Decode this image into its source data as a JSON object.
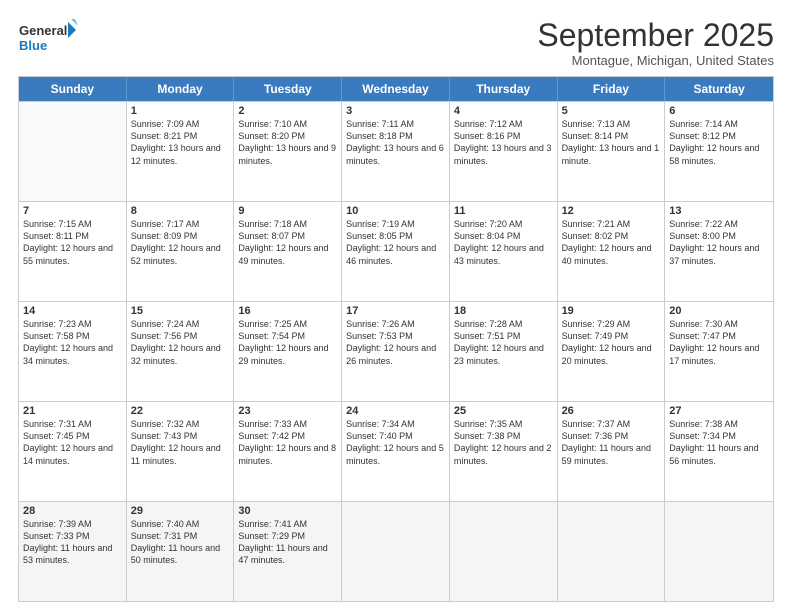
{
  "logo": {
    "line1": "General",
    "line2": "Blue"
  },
  "title": "September 2025",
  "location": "Montague, Michigan, United States",
  "header_days": [
    "Sunday",
    "Monday",
    "Tuesday",
    "Wednesday",
    "Thursday",
    "Friday",
    "Saturday"
  ],
  "weeks": [
    [
      {
        "day": "",
        "sunrise": "",
        "sunset": "",
        "daylight": ""
      },
      {
        "day": "1",
        "sunrise": "Sunrise: 7:09 AM",
        "sunset": "Sunset: 8:21 PM",
        "daylight": "Daylight: 13 hours and 12 minutes."
      },
      {
        "day": "2",
        "sunrise": "Sunrise: 7:10 AM",
        "sunset": "Sunset: 8:20 PM",
        "daylight": "Daylight: 13 hours and 9 minutes."
      },
      {
        "day": "3",
        "sunrise": "Sunrise: 7:11 AM",
        "sunset": "Sunset: 8:18 PM",
        "daylight": "Daylight: 13 hours and 6 minutes."
      },
      {
        "day": "4",
        "sunrise": "Sunrise: 7:12 AM",
        "sunset": "Sunset: 8:16 PM",
        "daylight": "Daylight: 13 hours and 3 minutes."
      },
      {
        "day": "5",
        "sunrise": "Sunrise: 7:13 AM",
        "sunset": "Sunset: 8:14 PM",
        "daylight": "Daylight: 13 hours and 1 minute."
      },
      {
        "day": "6",
        "sunrise": "Sunrise: 7:14 AM",
        "sunset": "Sunset: 8:12 PM",
        "daylight": "Daylight: 12 hours and 58 minutes."
      }
    ],
    [
      {
        "day": "7",
        "sunrise": "Sunrise: 7:15 AM",
        "sunset": "Sunset: 8:11 PM",
        "daylight": "Daylight: 12 hours and 55 minutes."
      },
      {
        "day": "8",
        "sunrise": "Sunrise: 7:17 AM",
        "sunset": "Sunset: 8:09 PM",
        "daylight": "Daylight: 12 hours and 52 minutes."
      },
      {
        "day": "9",
        "sunrise": "Sunrise: 7:18 AM",
        "sunset": "Sunset: 8:07 PM",
        "daylight": "Daylight: 12 hours and 49 minutes."
      },
      {
        "day": "10",
        "sunrise": "Sunrise: 7:19 AM",
        "sunset": "Sunset: 8:05 PM",
        "daylight": "Daylight: 12 hours and 46 minutes."
      },
      {
        "day": "11",
        "sunrise": "Sunrise: 7:20 AM",
        "sunset": "Sunset: 8:04 PM",
        "daylight": "Daylight: 12 hours and 43 minutes."
      },
      {
        "day": "12",
        "sunrise": "Sunrise: 7:21 AM",
        "sunset": "Sunset: 8:02 PM",
        "daylight": "Daylight: 12 hours and 40 minutes."
      },
      {
        "day": "13",
        "sunrise": "Sunrise: 7:22 AM",
        "sunset": "Sunset: 8:00 PM",
        "daylight": "Daylight: 12 hours and 37 minutes."
      }
    ],
    [
      {
        "day": "14",
        "sunrise": "Sunrise: 7:23 AM",
        "sunset": "Sunset: 7:58 PM",
        "daylight": "Daylight: 12 hours and 34 minutes."
      },
      {
        "day": "15",
        "sunrise": "Sunrise: 7:24 AM",
        "sunset": "Sunset: 7:56 PM",
        "daylight": "Daylight: 12 hours and 32 minutes."
      },
      {
        "day": "16",
        "sunrise": "Sunrise: 7:25 AM",
        "sunset": "Sunset: 7:54 PM",
        "daylight": "Daylight: 12 hours and 29 minutes."
      },
      {
        "day": "17",
        "sunrise": "Sunrise: 7:26 AM",
        "sunset": "Sunset: 7:53 PM",
        "daylight": "Daylight: 12 hours and 26 minutes."
      },
      {
        "day": "18",
        "sunrise": "Sunrise: 7:28 AM",
        "sunset": "Sunset: 7:51 PM",
        "daylight": "Daylight: 12 hours and 23 minutes."
      },
      {
        "day": "19",
        "sunrise": "Sunrise: 7:29 AM",
        "sunset": "Sunset: 7:49 PM",
        "daylight": "Daylight: 12 hours and 20 minutes."
      },
      {
        "day": "20",
        "sunrise": "Sunrise: 7:30 AM",
        "sunset": "Sunset: 7:47 PM",
        "daylight": "Daylight: 12 hours and 17 minutes."
      }
    ],
    [
      {
        "day": "21",
        "sunrise": "Sunrise: 7:31 AM",
        "sunset": "Sunset: 7:45 PM",
        "daylight": "Daylight: 12 hours and 14 minutes."
      },
      {
        "day": "22",
        "sunrise": "Sunrise: 7:32 AM",
        "sunset": "Sunset: 7:43 PM",
        "daylight": "Daylight: 12 hours and 11 minutes."
      },
      {
        "day": "23",
        "sunrise": "Sunrise: 7:33 AM",
        "sunset": "Sunset: 7:42 PM",
        "daylight": "Daylight: 12 hours and 8 minutes."
      },
      {
        "day": "24",
        "sunrise": "Sunrise: 7:34 AM",
        "sunset": "Sunset: 7:40 PM",
        "daylight": "Daylight: 12 hours and 5 minutes."
      },
      {
        "day": "25",
        "sunrise": "Sunrise: 7:35 AM",
        "sunset": "Sunset: 7:38 PM",
        "daylight": "Daylight: 12 hours and 2 minutes."
      },
      {
        "day": "26",
        "sunrise": "Sunrise: 7:37 AM",
        "sunset": "Sunset: 7:36 PM",
        "daylight": "Daylight: 11 hours and 59 minutes."
      },
      {
        "day": "27",
        "sunrise": "Sunrise: 7:38 AM",
        "sunset": "Sunset: 7:34 PM",
        "daylight": "Daylight: 11 hours and 56 minutes."
      }
    ],
    [
      {
        "day": "28",
        "sunrise": "Sunrise: 7:39 AM",
        "sunset": "Sunset: 7:33 PM",
        "daylight": "Daylight: 11 hours and 53 minutes."
      },
      {
        "day": "29",
        "sunrise": "Sunrise: 7:40 AM",
        "sunset": "Sunset: 7:31 PM",
        "daylight": "Daylight: 11 hours and 50 minutes."
      },
      {
        "day": "30",
        "sunrise": "Sunrise: 7:41 AM",
        "sunset": "Sunset: 7:29 PM",
        "daylight": "Daylight: 11 hours and 47 minutes."
      },
      {
        "day": "",
        "sunrise": "",
        "sunset": "",
        "daylight": ""
      },
      {
        "day": "",
        "sunrise": "",
        "sunset": "",
        "daylight": ""
      },
      {
        "day": "",
        "sunrise": "",
        "sunset": "",
        "daylight": ""
      },
      {
        "day": "",
        "sunrise": "",
        "sunset": "",
        "daylight": ""
      }
    ]
  ]
}
